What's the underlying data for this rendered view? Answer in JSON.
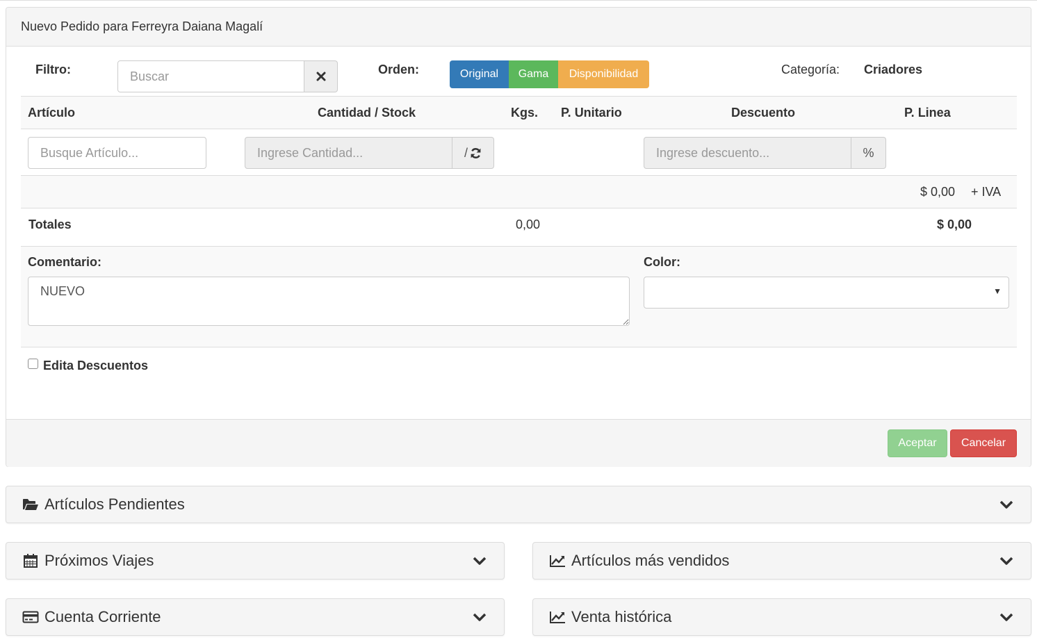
{
  "panel": {
    "title": "Nuevo Pedido para Ferreyra Daiana Magalí"
  },
  "filter": {
    "label": "Filtro:",
    "placeholder": "Buscar",
    "value": "",
    "clear_icon": "times-icon"
  },
  "order": {
    "label": "Orden:",
    "buttons": [
      {
        "label": "Original",
        "color": "#337ab7"
      },
      {
        "label": "Gama",
        "color": "#5cb85c"
      },
      {
        "label": "Disponibilidad",
        "color": "#f0ad4e"
      }
    ]
  },
  "category": {
    "label": "Categoría:",
    "value": "Criadores"
  },
  "table": {
    "headers": [
      "Artículo",
      "Cantidad / Stock",
      "Kgs.",
      "P. Unitario",
      "Descuento",
      "P. Linea"
    ],
    "article_placeholder": "Busque Artículo...",
    "quantity_placeholder": "Ingrese Cantidad...",
    "stock_addon": "/",
    "refresh_icon": "refresh-icon",
    "discount_placeholder": "Ingrese descuento...",
    "discount_addon": "%",
    "subtotal_amount": "$ 0,00",
    "subtotal_suffix": "+ IVA"
  },
  "totals": {
    "label": "Totales",
    "kgs": "0,00",
    "amount": "$ 0,00"
  },
  "comment": {
    "label": "Comentario:",
    "value": "NUEVO"
  },
  "color": {
    "label": "Color:",
    "selected": ""
  },
  "edit_discounts": {
    "label": "Edita Descuentos",
    "checked": false
  },
  "footer": {
    "accept_label": "Aceptar",
    "cancel_label": "Cancelar",
    "accept_color": "#91d191",
    "cancel_color": "#d9534f"
  },
  "sections": [
    {
      "title": "Artículos Pendientes",
      "icon": "folder-open-icon"
    },
    {
      "title": "Próximos Viajes",
      "icon": "calendar-icon"
    },
    {
      "title": "Artículos más vendidos",
      "icon": "line-chart-icon"
    },
    {
      "title": "Cuenta Corriente",
      "icon": "credit-card-icon"
    },
    {
      "title": "Venta histórica",
      "icon": "line-chart-icon"
    }
  ]
}
